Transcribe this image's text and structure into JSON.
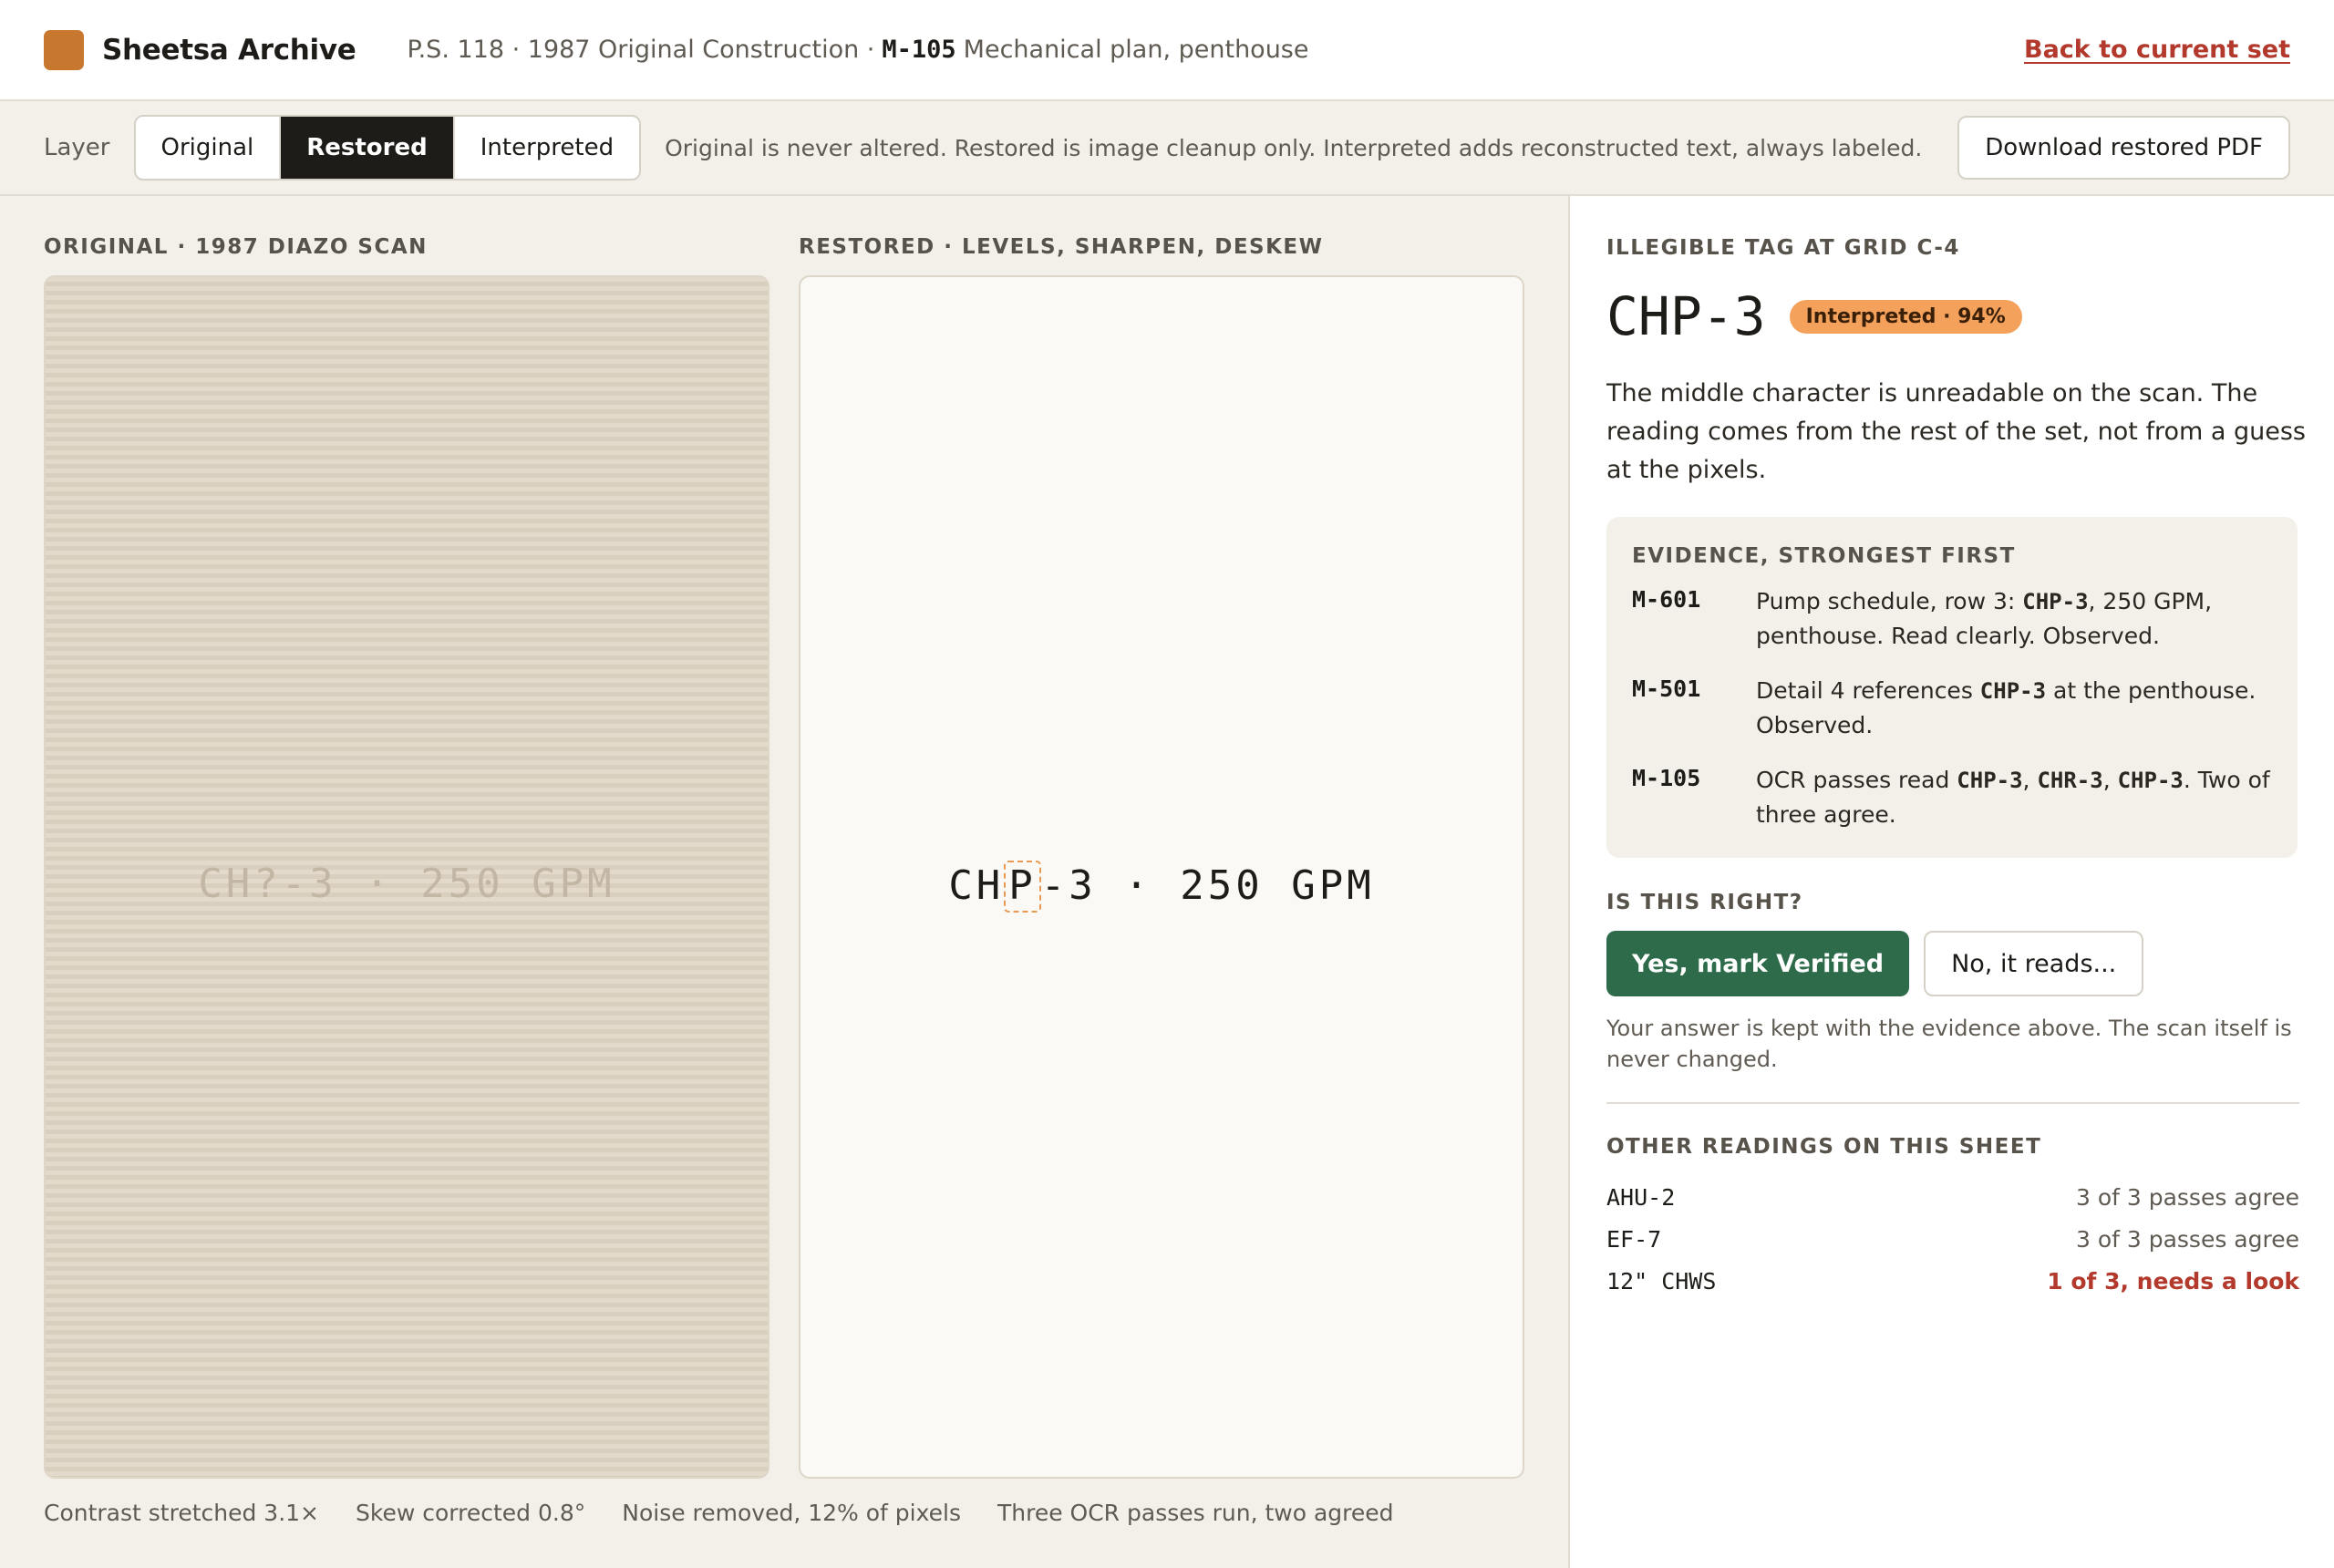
{
  "header": {
    "brand": "Sheetsa Archive",
    "crumb_prefix": "P.S. 118 · 1987 Original Construction ·",
    "sheet_id": "M-105",
    "sheet_title": "Mechanical plan, penthouse",
    "back_link": "Back to current set"
  },
  "toolbar": {
    "layer_label": "Layer",
    "layers": [
      "Original",
      "Restored",
      "Interpreted"
    ],
    "active_layer": "Restored",
    "note": "Original is never altered. Restored is image cleanup only. Interpreted adds reconstructed text, always labeled.",
    "download_label": "Download restored PDF"
  },
  "panels": {
    "original_label": "ORIGINAL · 1987 DIAZO SCAN",
    "original_text": "CH?-3 · 250 GPM",
    "restored_label": "RESTORED · LEVELS, SHARPEN, DESKEW",
    "restored_pre": "CH",
    "restored_highlight": "P",
    "restored_post": "-3 · 250 GPM"
  },
  "stats": [
    "Contrast stretched 3.1×",
    "Skew corrected 0.8°",
    "Noise removed, 12% of pixels",
    "Three OCR passes run, two agreed"
  ],
  "sidebar": {
    "section_label": "ILLEGIBLE TAG AT GRID C-4",
    "tag": "CHP-3",
    "badge": "Interpreted · 94%",
    "description": "The middle character is unreadable on the scan. The reading comes from the rest of the set, not from a guess at the pixels.",
    "evidence_label": "EVIDENCE, STRONGEST FIRST",
    "evidence": [
      {
        "sheet": "M-601",
        "t1": "Pump schedule, row 3: ",
        "m1": "CHP-3",
        "t2": ", 250 GPM, penthouse. Read clearly. Observed.",
        "m2": "",
        "t3": "",
        "m3": "",
        "t4": ""
      },
      {
        "sheet": "M-501",
        "t1": "Detail 4 references ",
        "m1": "CHP-3",
        "t2": " at the penthouse. Observed.",
        "m2": "",
        "t3": "",
        "m3": "",
        "t4": ""
      },
      {
        "sheet": "M-105",
        "t1": "OCR passes read ",
        "m1": "CHP-3",
        "t2": ", ",
        "m2": "CHR-3",
        "t3": ", ",
        "m3": "CHP-3",
        "t4": ". Two of three agree."
      }
    ],
    "question_label": "IS THIS RIGHT?",
    "yes_label": "Yes, mark Verified",
    "no_label": "No, it reads...",
    "answer_note": "Your answer is kept with the evidence above. The scan itself is never changed.",
    "other_label": "OTHER READINGS ON THIS SHEET",
    "other_readings": [
      {
        "tag": "AHU-2",
        "status": "3 of 3 passes agree"
      },
      {
        "tag": "EF-7",
        "status": "3 of 3 passes agree"
      },
      {
        "tag": "12\" CHWS",
        "status": "1 of 3, needs a look"
      }
    ]
  },
  "colors": {
    "brand": "#c8772f",
    "verify": "#2e6b4a",
    "interpreted_badge": "#f4a15c",
    "warn": "#b2392b"
  }
}
